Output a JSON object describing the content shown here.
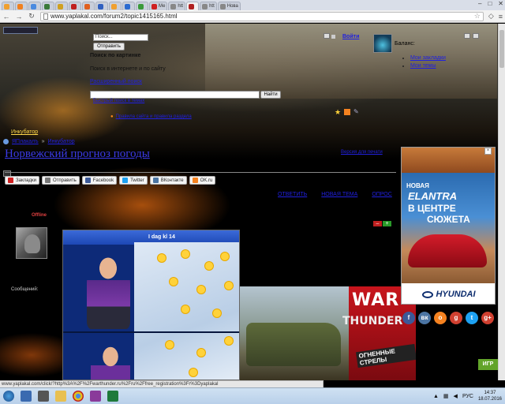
{
  "browser": {
    "tabs": [
      {
        "label": "",
        "color": "#f0a030",
        "active": false
      },
      {
        "label": "",
        "color": "#f08020",
        "active": false
      },
      {
        "label": "",
        "color": "#4a8ae0",
        "active": false
      },
      {
        "label": "",
        "color": "#3a7a3a",
        "active": false
      },
      {
        "label": "",
        "color": "#d0a020",
        "active": false
      },
      {
        "label": "",
        "color": "#c02020",
        "active": false
      },
      {
        "label": "",
        "color": "#e06020",
        "active": false
      },
      {
        "label": "",
        "color": "#3060c0",
        "active": false
      },
      {
        "label": "",
        "color": "#f0a030",
        "active": false
      },
      {
        "label": "",
        "color": "#2a6ad0",
        "active": false
      },
      {
        "label": "",
        "color": "#3a9a3a",
        "active": false
      },
      {
        "label": "Ме",
        "color": "#d02020",
        "active": false
      },
      {
        "label": "htt",
        "color": "#888888",
        "active": false
      },
      {
        "label": "",
        "color": "#b02020",
        "active": true
      },
      {
        "label": "htt",
        "color": "#888888",
        "active": false
      },
      {
        "label": "Нова",
        "color": "#888888",
        "active": false
      }
    ],
    "url": "www.yaplakal.com/forum2/topic1415165.html",
    "status_url": "www.yaplakal.com/click/?http%3A%2F%2Fwarthunder.ru%2Fru%2Ffree_registration%3Fr%3Dyaplakal"
  },
  "header": {
    "search_placeholder": "Поиск...",
    "search_button": "Отправить",
    "search_pics_title": "Поиск по картинке",
    "search_site_text": "Поиск в интернете и по сайту",
    "ext_search": "Расширенный поиск",
    "find_button": "Найти",
    "quick_search": "Быстрый поиск в темах"
  },
  "user": {
    "login": "Войти",
    "username": "",
    "balance": "Баланс:",
    "links": [
      "Мои закладки",
      "Мои темы"
    ]
  },
  "rules": "Правила сайта и правила раздела",
  "forum_nav": {
    "prefix": "",
    "current": "Инкубатор",
    "suffix": ""
  },
  "breadcrumb": [
    "ЯПлакалъ",
    "Инкубатор"
  ],
  "topic": {
    "title": "Норвежский прогноз погоды",
    "print_link": "Версия для печати"
  },
  "share": [
    {
      "label": "Закладки",
      "color": "#d02020"
    },
    {
      "label": "Отправить",
      "color": "#777777"
    },
    {
      "label": "Facebook",
      "color": "#3b5998"
    },
    {
      "label": "Twitter",
      "color": "#1da1f2"
    },
    {
      "label": "ВКонтакте",
      "color": "#4c75a3"
    },
    {
      "label": "OK.ru",
      "color": "#f58220"
    }
  ],
  "reply_links": [
    "ОТВЕТИТЬ",
    "НОВАЯ ТЕМА",
    "ОПРОС"
  ],
  "post": {
    "author": "",
    "badge": "",
    "status": "Offline",
    "meta": "Сообщений:"
  },
  "weather_caption": "I dag kl 14",
  "game_ad": {
    "war": "WAR",
    "thunder": "THUNDER",
    "tagline": "ОГНЕННЫЕ СТРЕЛЫ"
  },
  "car_ad": {
    "novaya": "НОВАЯ",
    "model": "ELANTRA",
    "line2": "В ЦЕНТРЕ",
    "line3": "СЮЖЕТА",
    "brand": "HYUNDAI"
  },
  "social": [
    {
      "label": "f",
      "color": "#3b5998"
    },
    {
      "label": "вк",
      "color": "#4c75a3"
    },
    {
      "label": "о",
      "color": "#f58220"
    },
    {
      "label": "g",
      "color": "#d04030"
    },
    {
      "label": "t",
      "color": "#1da1f2"
    },
    {
      "label": "g+",
      "color": "#d04030"
    }
  ],
  "side_heading": "",
  "side_link": "",
  "play_button": "ИГР",
  "taskbar": {
    "lang": "РУС",
    "time": "14:37",
    "date": "18.07.2016"
  }
}
